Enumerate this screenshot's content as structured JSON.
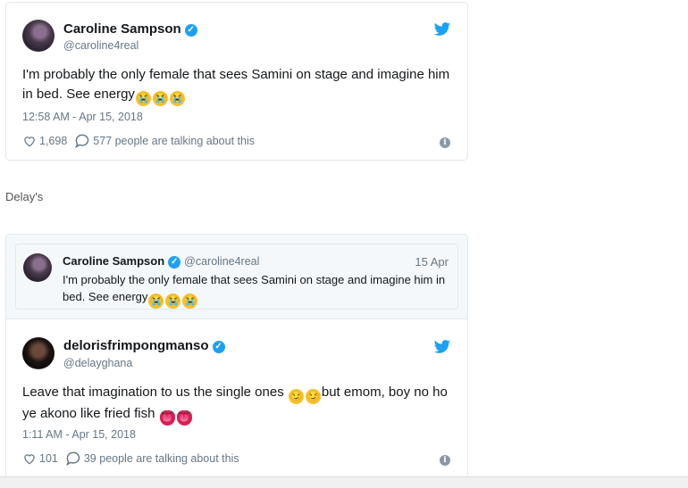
{
  "tweet1": {
    "name": "Caroline Sampson",
    "handle": "@caroline4real",
    "text": "I'm probably the only female that sees Samini on stage and imagine him in bed. See energy",
    "emojis": [
      "cry",
      "cry",
      "cry"
    ],
    "timestamp": "12:58 AM - Apr 15, 2018",
    "likes": "1,698",
    "talking": "577 people are talking about this"
  },
  "separator": "Delay's",
  "tweet2": {
    "quoted": {
      "name": "Caroline Sampson",
      "handle": "@caroline4real",
      "date": "15 Apr",
      "text": "I'm probably the only female that sees Samini on stage and imagine him in bed. See energy"
    },
    "name": "delorisfrimpongmanso",
    "handle": "@delayghana",
    "text_part1": "Leave that imagination to us the single ones",
    "text_part2": "but emom, boy no ho ye akono like fried fish",
    "timestamp": "1:11 AM - Apr 15, 2018",
    "likes": "101",
    "talking": "39 people are talking about this"
  },
  "colors": {
    "twitter_blue": "#1da1f2",
    "muted": "#657786",
    "border": "#e1e8ed"
  },
  "icons": [
    "twitter-bird-icon",
    "verified-icon",
    "heart-icon",
    "comment-icon",
    "info-icon",
    "crying-emoji",
    "smirk-emoji",
    "tongue-emoji"
  ]
}
